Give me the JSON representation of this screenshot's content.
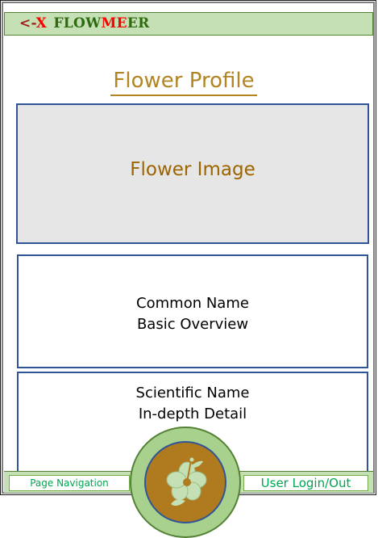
{
  "header": {
    "back_label": "<-",
    "close_label": "X",
    "logo_part1": "FLOW",
    "logo_part2": "ME",
    "logo_part3": "ER"
  },
  "page": {
    "title": "Flower Profile"
  },
  "image_placeholder": {
    "label": "Flower Image"
  },
  "sections": {
    "common_name": "Common Name",
    "basic_overview": "Basic Overview",
    "scientific_name": "Scientific Name",
    "indepth_detail": "In-depth Detail"
  },
  "footer": {
    "nav_label": "Page Navigation",
    "login_label": "User Login/Out",
    "home_icon": "hibiscus-flower-icon"
  },
  "colors": {
    "bar_green": "#c5e0b4",
    "title_gold": "#b28422",
    "box_border": "#2f5597",
    "accent_green": "#00a651",
    "home_brown": "#b07a1e"
  }
}
